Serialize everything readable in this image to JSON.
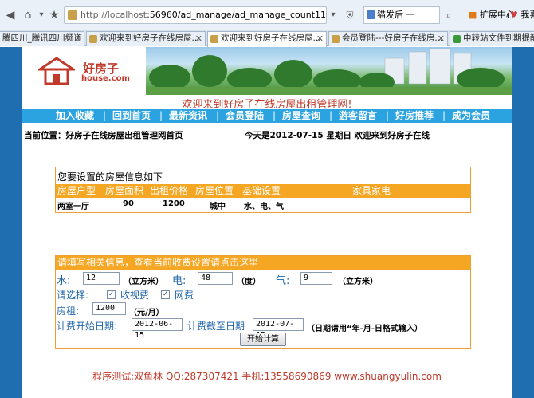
{
  "browser": {
    "url_prefix": "http://localhost",
    "url_rest": ":56960/ad_manage/ad_manage_count11.asp",
    "search_text": "猫发后 一",
    "ext_center": "扩展中心",
    "ext_fav": "我喜欢",
    "tabs": [
      {
        "label": "腾四川_腾讯四川频道"
      },
      {
        "label": "欢迎来到好房子在线房屋..."
      },
      {
        "label": "欢迎来到好房子在线房屋..."
      },
      {
        "label": "会员登陆---好房子在线房..."
      },
      {
        "label": "中转站文件到期提醒"
      }
    ]
  },
  "logo": {
    "cn": "好房子",
    "en": "house.com"
  },
  "welcome": "欢迎来到好房子在线房屋出租管理网!",
  "menu": [
    "加入收藏",
    "回到首页",
    "最新资讯",
    "会员登陆",
    "房屋查询",
    "游客留言",
    "好房推荐",
    "成为会员"
  ],
  "location": "当前位置：好房子在线房屋出租管理网首页",
  "today": "今天是2012-07-15   星期日 欢迎来到好房子在线",
  "info": {
    "caption": "您要设置的房屋信息如下",
    "headers": [
      "房屋户型",
      "房屋面积",
      "出租价格",
      "房屋位置",
      "基础设置",
      "家具家电"
    ],
    "row": [
      "两室一厅",
      "90",
      "1200",
      "城中",
      "水、电、气",
      ""
    ]
  },
  "form": {
    "header": "请填写相关信息，查看当前收费设置请点击这里",
    "water_label": "水:",
    "water_value": "12",
    "water_unit": "（立方米）",
    "elec_label": "电:",
    "elec_value": "48",
    "elec_unit": "（度）",
    "gas_label": "气:",
    "gas_value": "9",
    "gas_unit": "（立方米）",
    "choose_label": "请选择:",
    "tv_label": "收视费",
    "net_label": "网费",
    "rent_label": "房租:",
    "rent_value": "1200",
    "rent_unit": "（元/月）",
    "start_label": "计费开始日期:",
    "start_value": "2012-06-15",
    "end_label": "计费截至日期",
    "end_value": "2012-07-15",
    "date_hint": "（日期请用“年-月-日格式输入）",
    "submit": "开始计算"
  },
  "footer": "程序测试:双鱼林 QQ:287307421 手机:13558690869 www.shuangyulin.com"
}
